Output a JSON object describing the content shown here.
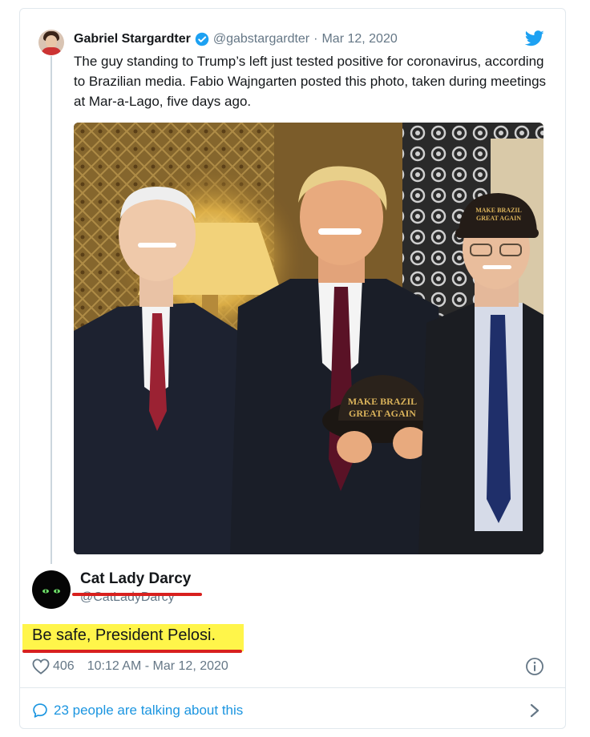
{
  "quoted_tweet": {
    "author_name": "Gabriel Stargardter",
    "author_handle": "@gabstargardter",
    "separator": "·",
    "date": "Mar 12, 2020",
    "text": "The guy standing to Trump’s left just tested positive for coronavirus, according to Brazilian media. Fabio Wajngarten posted this photo, taken during meetings at Mar-a-Lago, five days ago.",
    "verified": true,
    "photo": {
      "cap_text_line1": "MAKE BRAZIL",
      "cap_text_line2": "GREAT AGAIN"
    }
  },
  "main_tweet": {
    "author_name": "Cat Lady Darcy",
    "author_handle": "@CatLadyDarcy",
    "text": "Be safe, President Pelosi."
  },
  "meta": {
    "like_count": "406",
    "time": "10:12 AM - Mar 12, 2020"
  },
  "footer": {
    "conversation_text": "23 people are talking about this"
  },
  "icons": {
    "verified": "verified-badge-icon",
    "brand": "twitter-bird-icon",
    "like": "heart-icon",
    "info": "info-icon",
    "conversation": "speech-bubble-icon",
    "expand": "chevron-right-icon"
  },
  "colors": {
    "accent": "#1da1f2",
    "link": "#1b95e0",
    "muted": "#657786",
    "highlight": "#fff54a",
    "annotation": "#d8201e"
  }
}
